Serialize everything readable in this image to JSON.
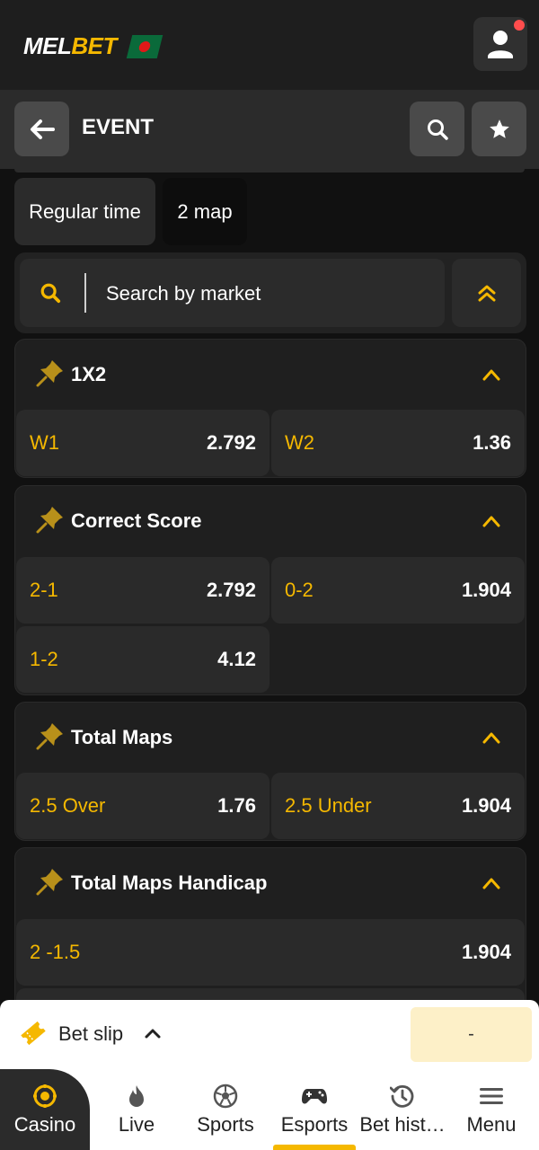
{
  "header": {
    "logo_left": "MEL",
    "logo_right": "BET",
    "flag_icon": "bangladesh-flag-icon",
    "user_icon": "user-icon"
  },
  "event_bar": {
    "title": "EVENT",
    "back_icon": "arrow-left-icon",
    "search_icon": "search-icon",
    "favorite_icon": "star-icon"
  },
  "tabs": [
    {
      "label": "Regular time",
      "active": false
    },
    {
      "label": "2 map",
      "active": true
    }
  ],
  "search": {
    "placeholder": "Search by market"
  },
  "markets": [
    {
      "title": "1X2",
      "odds": [
        {
          "label": "W1",
          "value": "2.792"
        },
        {
          "label": "W2",
          "value": "1.36"
        }
      ]
    },
    {
      "title": "Correct Score",
      "odds": [
        {
          "label": "2-1",
          "value": "2.792"
        },
        {
          "label": "0-2",
          "value": "1.904"
        },
        {
          "label": "1-2",
          "value": "4.12"
        }
      ]
    },
    {
      "title": "Total Maps",
      "odds": [
        {
          "label": "2.5 Over",
          "value": "1.76"
        },
        {
          "label": "2.5 Under",
          "value": "1.904"
        }
      ]
    },
    {
      "title": "Total Maps Handicap",
      "odds": [
        {
          "label": "2 -1.5",
          "value": "1.904"
        }
      ]
    }
  ],
  "bet_slip": {
    "label": "Bet slip",
    "value": "-"
  },
  "bottom_nav": [
    {
      "label": "Casino",
      "icon": "casino-chip-icon",
      "active": true
    },
    {
      "label": "Live",
      "icon": "flame-icon",
      "active": false
    },
    {
      "label": "Sports",
      "icon": "soccer-ball-icon",
      "active": false
    },
    {
      "label": "Esports",
      "icon": "gamepad-icon",
      "active": false
    },
    {
      "label": "Bet hist…",
      "icon": "history-icon",
      "active": false
    },
    {
      "label": "Menu",
      "icon": "hamburger-menu-icon",
      "active": false
    }
  ],
  "colors": {
    "accent": "#f5b800",
    "background": "#111111",
    "card": "#1f1f1f",
    "odd_cell": "#2a2a2a"
  }
}
